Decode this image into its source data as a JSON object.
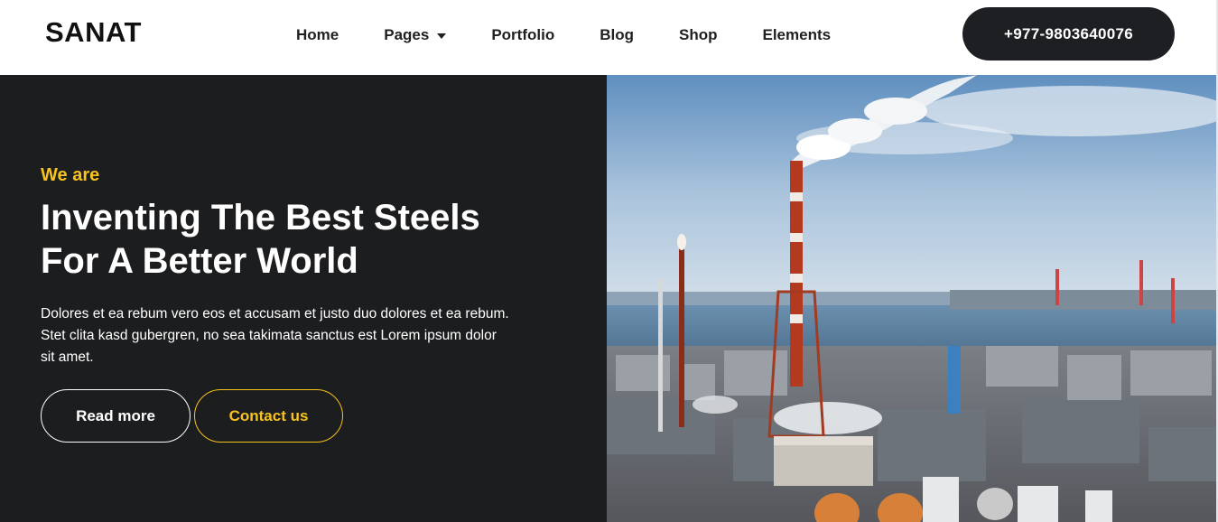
{
  "header": {
    "logo": "SANAT",
    "nav": [
      {
        "label": "Home",
        "has_dropdown": false
      },
      {
        "label": "Pages",
        "has_dropdown": true
      },
      {
        "label": "Portfolio",
        "has_dropdown": false
      },
      {
        "label": "Blog",
        "has_dropdown": false
      },
      {
        "label": "Shop",
        "has_dropdown": false
      },
      {
        "label": "Elements",
        "has_dropdown": false
      }
    ],
    "phone": "+977-9803640076"
  },
  "hero": {
    "eyebrow": "We are",
    "headline_line1": "Inventing The Best Steels",
    "headline_line2": "For A Better World",
    "description": "Dolores et ea rebum vero eos et accusam et justo duo dolores et ea rebum. Stet clita kasd gubergren, no sea takimata sanctus est Lorem ipsum dolor sit amet.",
    "read_more": "Read more",
    "contact": "Contact us",
    "image_icon": "industrial-refinery-photo"
  },
  "colors": {
    "accent": "#f8c21c",
    "dark": "#1c1d1f",
    "button_dark": "#1d1f22",
    "white": "#ffffff"
  }
}
